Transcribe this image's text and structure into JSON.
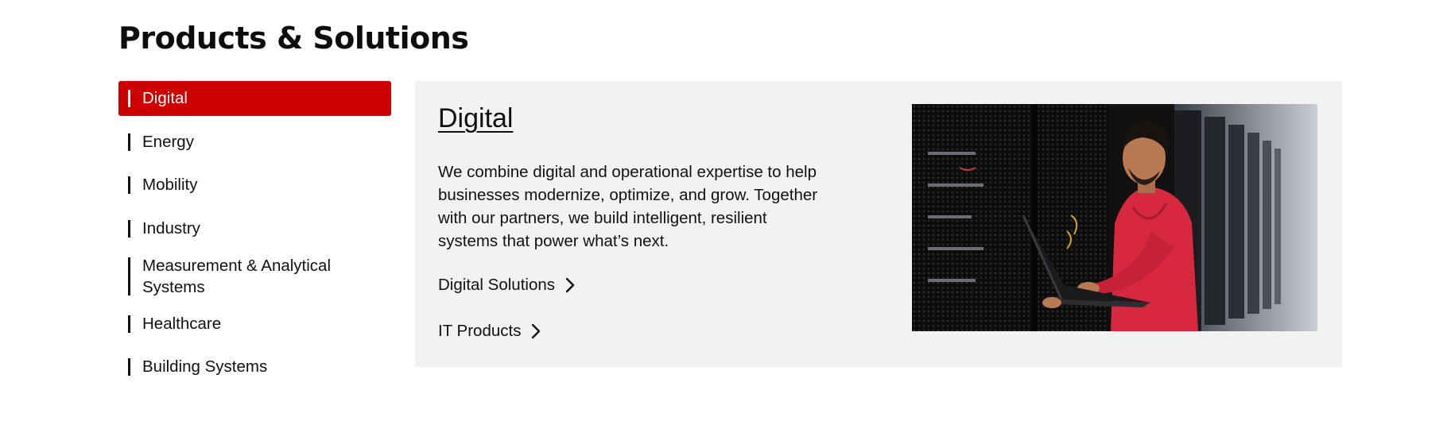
{
  "page": {
    "title": "Products & Solutions"
  },
  "nav": {
    "items": [
      {
        "label": "Digital",
        "active": true
      },
      {
        "label": "Energy"
      },
      {
        "label": "Mobility"
      },
      {
        "label": "Industry"
      },
      {
        "label_line1": "Measurement & Analytical",
        "label_line2": "Systems"
      },
      {
        "label": "Healthcare"
      },
      {
        "label": "Building Systems"
      }
    ]
  },
  "panel": {
    "title": "Digital",
    "desc_lines": [
      "We combine digital and operational expertise to help",
      "businesses modernize, optimize, and grow. Together",
      "with our partners, we build intelligent, resilient",
      "systems that power what’s next."
    ],
    "links": [
      {
        "label": "Digital Solutions",
        "icon": "chevron-right-icon"
      },
      {
        "label": "IT Products",
        "icon": "chevron-right-icon"
      }
    ],
    "image_alt": "Engineer with laptop in data center"
  },
  "colors": {
    "accent": "#cc0000",
    "panel_bg": "#f2f2f2",
    "text": "#111111"
  }
}
